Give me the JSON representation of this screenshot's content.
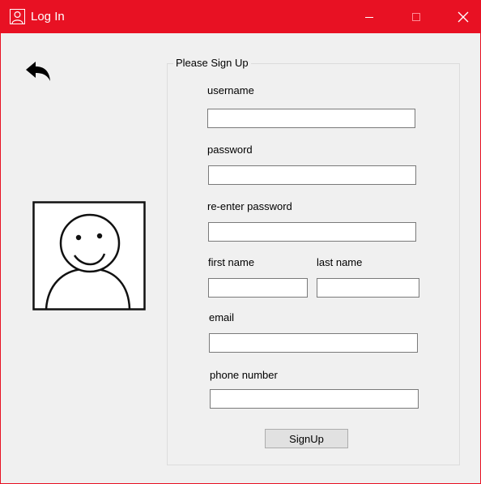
{
  "window": {
    "title": "Log In",
    "accent_color": "#e81123",
    "controls": {
      "minimize": "minimize-icon",
      "maximize": "maximize-icon",
      "close": "close-icon"
    }
  },
  "toolbar": {
    "back_icon": "back-arrow-icon"
  },
  "profile": {
    "icon": "user-avatar-icon"
  },
  "form": {
    "group_title": "Please Sign Up",
    "username": {
      "label": "username",
      "value": ""
    },
    "password": {
      "label": "password",
      "value": ""
    },
    "reenter_password": {
      "label": "re-enter password",
      "value": ""
    },
    "first_name": {
      "label": "first name",
      "value": ""
    },
    "last_name": {
      "label": "last name",
      "value": ""
    },
    "email": {
      "label": "email",
      "value": ""
    },
    "phone_number": {
      "label": "phone number",
      "value": ""
    },
    "submit_label": "SignUp"
  }
}
